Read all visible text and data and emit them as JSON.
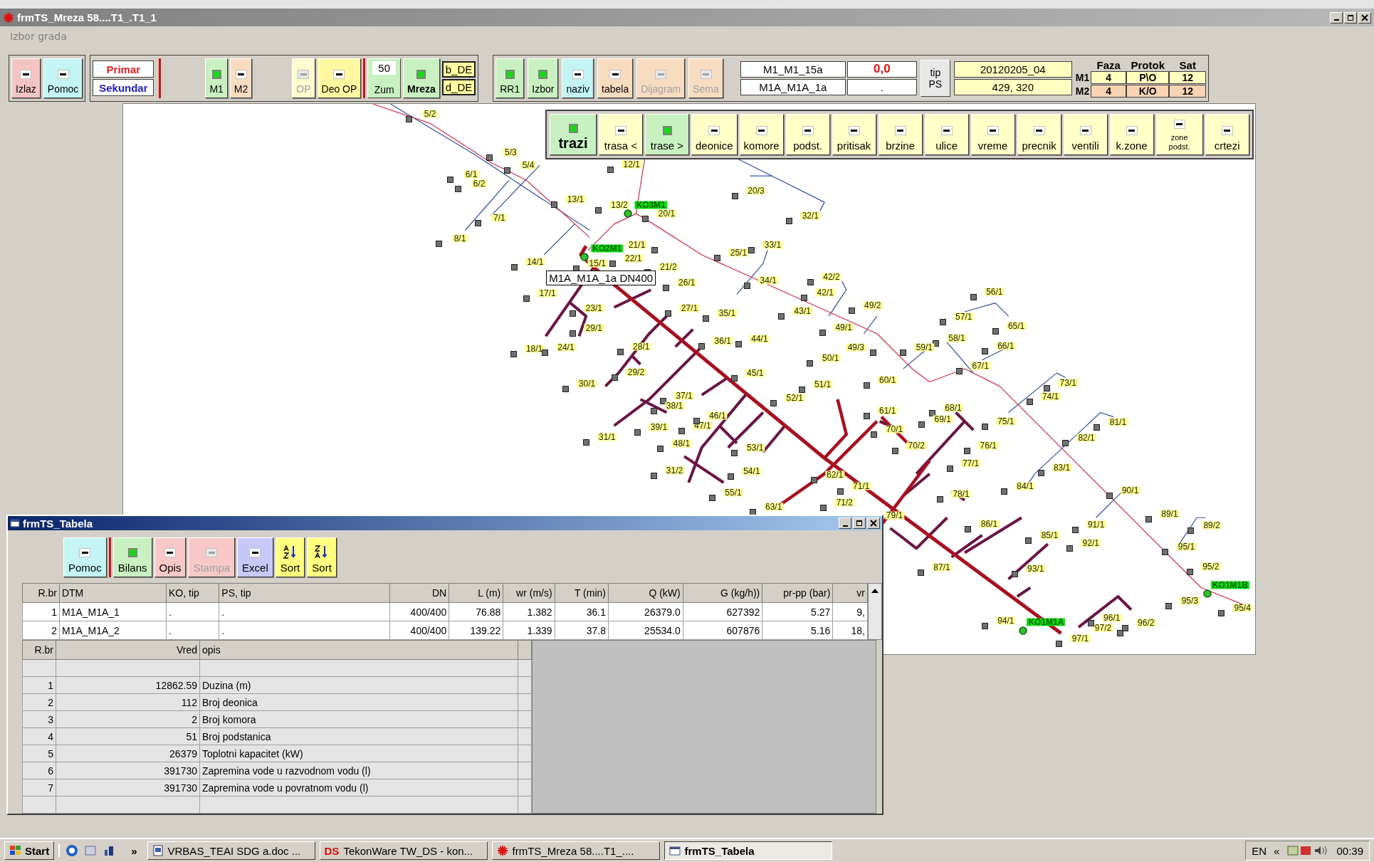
{
  "window": {
    "title": "frmTS_Mreza 58....T1_.T1_1"
  },
  "menu": [
    {
      "label": "Izbor grada",
      "disabled": true
    }
  ],
  "toolbar": {
    "exit_help": [
      {
        "label": "Izlaz",
        "color": "#f4c4c4",
        "on": false,
        "disabled": false,
        "emphasis": false
      },
      {
        "label": "Pomoc",
        "color": "#c4f4f4",
        "on": false,
        "disabled": false,
        "emphasis": false
      }
    ],
    "system": [
      {
        "label": "Primar",
        "color": "#e02020"
      },
      {
        "label": "Sekundar",
        "color": "#2020c0"
      }
    ],
    "buttons_a": [
      {
        "label": "M1",
        "color": "#c8f0c0",
        "on": true,
        "disabled": false,
        "emphasis": false
      },
      {
        "label": "M2",
        "color": "#f8dcc0",
        "on": false,
        "disabled": false,
        "emphasis": false
      }
    ],
    "buttons_b": [
      {
        "label": "OP",
        "color": "#fffcd0",
        "on": false,
        "disabled": true,
        "emphasis": false
      },
      {
        "label": "Deo OP",
        "color": "#fff8a0",
        "on": false,
        "disabled": false,
        "emphasis": false
      }
    ],
    "zoom": {
      "value": "50",
      "label": "Zum"
    },
    "buttons_m": [
      {
        "label": "Mreza",
        "color": "#c8f0c0",
        "on": true,
        "disabled": false,
        "emphasis": true
      }
    ],
    "de_toggles": [
      "b_DE",
      "d_DE"
    ],
    "buttons_c": [
      {
        "label": "RR1",
        "color": "#c8f0c0",
        "on": true,
        "disabled": false,
        "emphasis": false
      },
      {
        "label": "Izbor",
        "color": "#c8f0c0",
        "on": true,
        "disabled": false,
        "emphasis": false
      },
      {
        "label": "naziv",
        "color": "#c4f4f4",
        "on": false,
        "disabled": false,
        "emphasis": false
      },
      {
        "label": "tabela",
        "color": "#f8dcc0",
        "on": false,
        "disabled": false,
        "emphasis": false
      },
      {
        "label": "Dijagram",
        "color": "#f8dcc0",
        "on": false,
        "disabled": true,
        "emphasis": false
      },
      {
        "label": "Sema",
        "color": "#f8dcc0",
        "on": false,
        "disabled": true,
        "emphasis": false
      }
    ],
    "info": {
      "field_1": "M1_M1_15a",
      "value_1": "0,0",
      "field_2": "M1A_M1A_1a",
      "value_2": ".",
      "tip_button": [
        "tip",
        "PS"
      ],
      "date": "20120205_04",
      "coords": "429, 320"
    },
    "phase_table": {
      "columns": [
        "Faza",
        "Protok",
        "Sat"
      ],
      "rows": [
        {
          "label": "M1",
          "cells": [
            "4",
            "P\\O",
            "12"
          ],
          "color": "#ffffc0"
        },
        {
          "label": "M2",
          "cells": [
            "4",
            "K/O",
            "12"
          ],
          "color": "#f8d4b4"
        }
      ]
    }
  },
  "layer_toolbar": [
    {
      "label": "trazi",
      "color": "#c8f0c0",
      "on": true,
      "disabled": false,
      "emphasis": true
    },
    {
      "label": "trasa <",
      "color": "#ffffc8",
      "on": false,
      "disabled": false,
      "emphasis": false
    },
    {
      "label": "trase >",
      "color": "#c8f0c0",
      "on": true,
      "disabled": false,
      "emphasis": false
    },
    {
      "label": "deonice",
      "color": "#ffffc8",
      "on": false,
      "disabled": false,
      "emphasis": false
    },
    {
      "label": "komore",
      "color": "#ffffc8",
      "on": false,
      "disabled": false,
      "emphasis": false
    },
    {
      "label": "podst.",
      "color": "#ffffc8",
      "on": false,
      "disabled": false,
      "emphasis": false
    },
    {
      "label": "pritisak",
      "color": "#ffffc8",
      "on": false,
      "disabled": false,
      "emphasis": false
    },
    {
      "label": "brzine",
      "color": "#ffffc8",
      "on": false,
      "disabled": false,
      "emphasis": false
    },
    {
      "label": "ulice",
      "color": "#ffffc8",
      "on": false,
      "disabled": false,
      "emphasis": false
    },
    {
      "label": "vreme",
      "color": "#ffffc8",
      "on": false,
      "disabled": false,
      "emphasis": false
    },
    {
      "label": "precnik",
      "color": "#ffffc8",
      "on": false,
      "disabled": false,
      "emphasis": false
    },
    {
      "label": "ventili",
      "color": "#ffffc8",
      "on": false,
      "disabled": false,
      "emphasis": false
    },
    {
      "label": "k.zone",
      "color": "#ffffc8",
      "on": false,
      "disabled": false,
      "emphasis": false
    },
    {
      "label": "zone podst.",
      "color": "#ffffc8",
      "on": false,
      "disabled": false,
      "emphasis": false
    },
    {
      "label": "crtezi",
      "color": "#ffffc8",
      "on": false,
      "disabled": false,
      "emphasis": false
    }
  ],
  "map": {
    "tooltip": "M1A_M1A_1a DN400",
    "labels": [
      {
        "text": "5/2",
        "kind": "node"
      },
      {
        "text": "5/3",
        "kind": "node"
      },
      {
        "text": "5/4",
        "kind": "node"
      },
      {
        "text": "12/1",
        "kind": "node"
      },
      {
        "text": "6/1",
        "kind": "node"
      },
      {
        "text": "6/2",
        "kind": "node"
      },
      {
        "text": "20/3",
        "kind": "node"
      },
      {
        "text": "13/1",
        "kind": "node"
      },
      {
        "text": "13/2",
        "kind": "node"
      },
      {
        "text": "KO3M1",
        "kind": "chamber"
      },
      {
        "text": "7/1",
        "kind": "node"
      },
      {
        "text": "20/1",
        "kind": "node"
      },
      {
        "text": "32/1",
        "kind": "node"
      },
      {
        "text": "8/1",
        "kind": "node"
      },
      {
        "text": "KO2M1",
        "kind": "chamber"
      },
      {
        "text": "21/1",
        "kind": "node"
      },
      {
        "text": "25/1",
        "kind": "node"
      },
      {
        "text": "33/1",
        "kind": "node"
      },
      {
        "text": "14/1",
        "kind": "node"
      },
      {
        "text": "15/1",
        "kind": "node"
      },
      {
        "text": "22/1",
        "kind": "node"
      },
      {
        "text": "21/2",
        "kind": "node"
      },
      {
        "text": "26/1",
        "kind": "node"
      },
      {
        "text": "34/1",
        "kind": "node"
      },
      {
        "text": "42/2",
        "kind": "node"
      },
      {
        "text": "17/1",
        "kind": "node"
      },
      {
        "text": "42/1",
        "kind": "node"
      },
      {
        "text": "56/1",
        "kind": "node"
      },
      {
        "text": "23/1",
        "kind": "node"
      },
      {
        "text": "27/1",
        "kind": "node"
      },
      {
        "text": "35/1",
        "kind": "node"
      },
      {
        "text": "43/1",
        "kind": "node"
      },
      {
        "text": "49/2",
        "kind": "node"
      },
      {
        "text": "57/1",
        "kind": "node"
      },
      {
        "text": "29/1",
        "kind": "node"
      },
      {
        "text": "49/1",
        "kind": "node"
      },
      {
        "text": "65/1",
        "kind": "node"
      },
      {
        "text": "36/1",
        "kind": "node"
      },
      {
        "text": "44/1",
        "kind": "node"
      },
      {
        "text": "58/1",
        "kind": "node"
      },
      {
        "text": "18/1",
        "kind": "node"
      },
      {
        "text": "24/1",
        "kind": "node"
      },
      {
        "text": "28/1",
        "kind": "node"
      },
      {
        "text": "49/3",
        "kind": "node"
      },
      {
        "text": "59/1",
        "kind": "node"
      },
      {
        "text": "66/1",
        "kind": "node"
      },
      {
        "text": "29/2",
        "kind": "node"
      },
      {
        "text": "45/1",
        "kind": "node"
      },
      {
        "text": "50/1",
        "kind": "node"
      },
      {
        "text": "67/1",
        "kind": "node"
      },
      {
        "text": "30/1",
        "kind": "node"
      },
      {
        "text": "51/1",
        "kind": "node"
      },
      {
        "text": "60/1",
        "kind": "node"
      },
      {
        "text": "73/1",
        "kind": "node"
      },
      {
        "text": "37/1",
        "kind": "node"
      },
      {
        "text": "52/1",
        "kind": "node"
      },
      {
        "text": "74/1",
        "kind": "node"
      },
      {
        "text": "38/1",
        "kind": "node"
      },
      {
        "text": "61/1",
        "kind": "node"
      },
      {
        "text": "68/1",
        "kind": "node"
      },
      {
        "text": "39/1",
        "kind": "node"
      },
      {
        "text": "47/1",
        "kind": "node"
      },
      {
        "text": "46/1",
        "kind": "node"
      },
      {
        "text": "70/1",
        "kind": "node"
      },
      {
        "text": "69/1",
        "kind": "node"
      },
      {
        "text": "75/1",
        "kind": "node"
      },
      {
        "text": "81/1",
        "kind": "node"
      },
      {
        "text": "31/1",
        "kind": "node"
      },
      {
        "text": "48/1",
        "kind": "node"
      },
      {
        "text": "53/1",
        "kind": "node"
      },
      {
        "text": "70/2",
        "kind": "node"
      },
      {
        "text": "76/1",
        "kind": "node"
      },
      {
        "text": "82/1",
        "kind": "node"
      },
      {
        "text": "31/2",
        "kind": "node"
      },
      {
        "text": "54/1",
        "kind": "node"
      },
      {
        "text": "62/1",
        "kind": "node"
      },
      {
        "text": "77/1",
        "kind": "node"
      },
      {
        "text": "83/1",
        "kind": "node"
      },
      {
        "text": "55/1",
        "kind": "node"
      },
      {
        "text": "71/1",
        "kind": "node"
      },
      {
        "text": "78/1",
        "kind": "node"
      },
      {
        "text": "84/1",
        "kind": "node"
      },
      {
        "text": "90/1",
        "kind": "node"
      },
      {
        "text": "63/1",
        "kind": "node"
      },
      {
        "text": "71/2",
        "kind": "node"
      },
      {
        "text": "79/1",
        "kind": "node"
      },
      {
        "text": "89/1",
        "kind": "node"
      },
      {
        "text": "86/1",
        "kind": "node"
      },
      {
        "text": "91/1",
        "kind": "node"
      },
      {
        "text": "89/2",
        "kind": "node"
      },
      {
        "text": "85/1",
        "kind": "node"
      },
      {
        "text": "92/1",
        "kind": "node"
      },
      {
        "text": "95/1",
        "kind": "node"
      },
      {
        "text": "87/1",
        "kind": "node"
      },
      {
        "text": "93/1",
        "kind": "node"
      },
      {
        "text": "95/2",
        "kind": "node"
      },
      {
        "text": "KO1M1B",
        "kind": "chamber"
      },
      {
        "text": "95/3",
        "kind": "node"
      },
      {
        "text": "95/4",
        "kind": "node"
      },
      {
        "text": "94/1",
        "kind": "node"
      },
      {
        "text": "KO1M1A",
        "kind": "chamber"
      },
      {
        "text": "97/2",
        "kind": "node"
      },
      {
        "text": "96/1",
        "kind": "node"
      },
      {
        "text": "96/2",
        "kind": "node"
      },
      {
        "text": "97/1",
        "kind": "node"
      }
    ]
  },
  "table_window": {
    "title": "frmTS_Tabela",
    "buttons": [
      {
        "label": "Pomoc",
        "kind": "indicator",
        "color": "#c4f4f4",
        "on": false,
        "disabled": false
      },
      {
        "label": "Bilans",
        "kind": "indicator",
        "color": "#c8f0c0",
        "on": true,
        "disabled": false
      },
      {
        "label": "Opis",
        "kind": "indicator",
        "color": "#f8c8c8",
        "on": false,
        "disabled": false
      },
      {
        "label": "Stampa",
        "kind": "indicator",
        "color": "#f8c8c8",
        "on": false,
        "disabled": true
      },
      {
        "label": "Excel",
        "kind": "indicator",
        "color": "#c8c8f8",
        "on": false,
        "disabled": false
      },
      {
        "label": "Sort",
        "kind": "sort_asc",
        "color": "#ffff80",
        "disabled": false
      },
      {
        "label": "Sort",
        "kind": "sort_desc",
        "color": "#ffff80",
        "disabled": false
      }
    ],
    "table": {
      "columns": [
        "R.br",
        "DTM",
        "KO, tip",
        "PS, tip",
        "DN",
        "L (m)",
        "wr (m/s)",
        "T (min)",
        "Q (kW)",
        "G (kg/h))",
        "pr-pp (bar)",
        "vr"
      ],
      "rows": [
        [
          "1",
          "M1A_M1A_1",
          ".",
          ".",
          "400/400",
          "76.88",
          "1.382",
          "36.1",
          "26379.0",
          "627392",
          "5.27",
          "9,"
        ],
        [
          "2",
          "M1A_M1A_2",
          ".",
          ".",
          "400/400",
          "139.22",
          "1.339",
          "37.8",
          "25534.0",
          "607876",
          "5.16",
          "18,"
        ]
      ]
    },
    "summary": {
      "columns": [
        "R.br",
        "Vred",
        "opis"
      ],
      "rows": [
        [
          "1",
          "12862.59",
          "Duzina (m)"
        ],
        [
          "2",
          "112",
          "Broj deonica"
        ],
        [
          "3",
          "2",
          "Broj komora"
        ],
        [
          "4",
          "51",
          "Broj podstanica"
        ],
        [
          "5",
          "26379",
          "Toplotni kapacitet (kW)"
        ],
        [
          "6",
          "391730",
          "Zapremina vode u razvodnom vodu (l)"
        ],
        [
          "7",
          "391730",
          "Zapremina vode u povratnom vodu (l)"
        ]
      ]
    }
  },
  "taskbar": {
    "start": "Start",
    "more": "»",
    "tasks": [
      {
        "label": "VRBAS_TEAI SDG a.doc ...",
        "kind": "document",
        "selected": false
      },
      {
        "label": "TekonWare TW_DS - kon...",
        "kind": "text_icon",
        "icon_text": "DS",
        "selected": false
      },
      {
        "label": "frmTS_Mreza 58....T1_....",
        "kind": "star",
        "selected": false
      },
      {
        "label": "frmTS_Tabela",
        "kind": "window",
        "selected": true
      }
    ],
    "language": "EN",
    "tray_toggle": "«",
    "clock": "00:39"
  }
}
